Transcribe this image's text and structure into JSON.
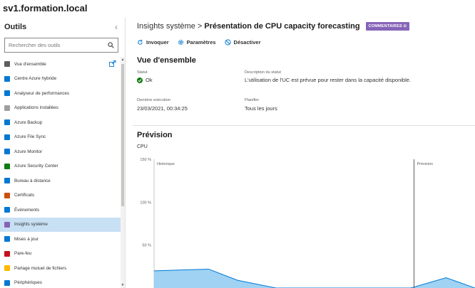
{
  "server": {
    "name": "sv1.formation.local"
  },
  "sidebar": {
    "title": "Outils",
    "search_placeholder": "Rechercher des outils",
    "items": [
      {
        "label": "Vue d'ensemble",
        "icon": "overview-icon",
        "color": "#605e5c"
      },
      {
        "label": "Centre Azure hybride",
        "icon": "azure-hybrid-icon",
        "color": "#0078d4"
      },
      {
        "label": "Analyseur de performances",
        "icon": "performance-icon",
        "color": "#0078d4"
      },
      {
        "label": "Applications installées",
        "icon": "apps-icon",
        "color": "#a19f9d"
      },
      {
        "label": "Azure Backup",
        "icon": "azure-backup-icon",
        "color": "#0078d4"
      },
      {
        "label": "Azure File Sync",
        "icon": "azure-file-sync-icon",
        "color": "#0078d4"
      },
      {
        "label": "Azure Monitor",
        "icon": "azure-monitor-icon",
        "color": "#0078d4"
      },
      {
        "label": "Azure Security Center",
        "icon": "security-center-icon",
        "color": "#107c10"
      },
      {
        "label": "Bureau à distance",
        "icon": "remote-desktop-icon",
        "color": "#0078d4"
      },
      {
        "label": "Certificats",
        "icon": "certificate-icon",
        "color": "#ca5010"
      },
      {
        "label": "Événements",
        "icon": "events-icon",
        "color": "#0078d4"
      },
      {
        "label": "Insights système",
        "icon": "system-insights-icon",
        "color": "#8764b8",
        "active": true
      },
      {
        "label": "Mises à jour",
        "icon": "updates-icon",
        "color": "#0078d4"
      },
      {
        "label": "Pare-feu",
        "icon": "firewall-icon",
        "color": "#c50f1f"
      },
      {
        "label": "Partage mutuel de fichiers",
        "icon": "file-share-icon",
        "color": "#ffb900"
      },
      {
        "label": "Périphériques",
        "icon": "devices-icon",
        "color": "#0078d4"
      }
    ]
  },
  "header": {
    "breadcrumb_parent": "Insights système",
    "breadcrumb_sep": ">",
    "breadcrumb_current": "Présentation de CPU capacity forecasting",
    "badge": "COMMENTAIRES ⊙"
  },
  "toolbar": {
    "invoke": "Invoquer",
    "settings": "Paramètres",
    "disable": "Désactiver"
  },
  "overview": {
    "title": "Vue d'ensemble",
    "status_label": "Statut",
    "status_value": "Ok",
    "status_desc_label": "Description du statut",
    "status_desc_value": "L'utilisation de l'UC est prévue pour rester dans la capacité disponible.",
    "last_run_label": "Dernière exécution",
    "last_run_value": "23/03/2021, 00:34:25",
    "schedule_label": "Planifier",
    "schedule_value": "Tous les jours"
  },
  "forecast": {
    "title": "Prévision",
    "subtitle": "CPU"
  },
  "chart_data": {
    "type": "area",
    "ylabel": "",
    "ylim": [
      0,
      150
    ],
    "yticks": [
      "150 %",
      "100 %",
      "50 %"
    ],
    "region_labels": [
      "Historique",
      "Prévision"
    ],
    "series": [
      {
        "values": [
          20,
          22,
          9,
          0,
          0,
          0,
          0,
          0,
          12,
          0
        ],
        "color": "#9fd2f3"
      }
    ],
    "x": [
      0,
      0.17,
      0.26,
      0.38,
      0.5,
      0.62,
      0.74,
      0.8,
      0.91,
      1.0
    ],
    "forecast_start_x": 0.81
  }
}
